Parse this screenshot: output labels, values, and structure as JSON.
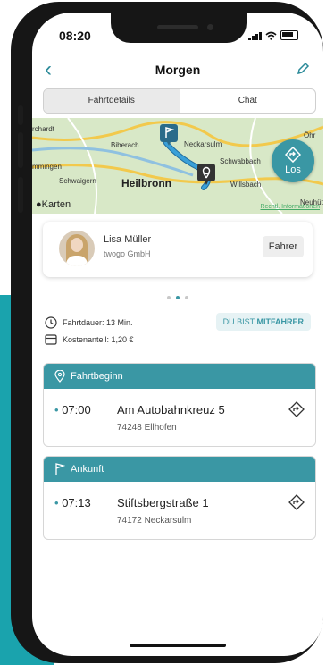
{
  "status_bar": {
    "time": "08:20"
  },
  "nav": {
    "title": "Morgen",
    "back_icon": "chevron-left-icon",
    "edit_icon": "pencil-icon"
  },
  "tabs": [
    {
      "label": "Fahrtdetails",
      "active": true
    },
    {
      "label": "Chat",
      "active": false
    }
  ],
  "map": {
    "places": [
      "rchardt",
      "Biberach",
      "Neckarsulm",
      "Schwabbach",
      "Öhr",
      "mmingen",
      "Schwaigern",
      "Heilbronn",
      "Willsbach",
      "Neuhütt"
    ],
    "provider": "Karten",
    "legal_link": "Rechtl. Informationen",
    "go_button_label": "Los"
  },
  "driver": {
    "name": "Lisa Müller",
    "company": "twogo GmbH",
    "role_label": "Fahrer"
  },
  "pager": {
    "count": 3,
    "active_index": 1
  },
  "trip_info": {
    "duration": "Fahrtdauer: 13 Min.",
    "cost": "Kostenanteil: 1,20 €",
    "badge_prefix": "DU BIST",
    "badge_strong": "MITFAHRER"
  },
  "start": {
    "header": "Fahrtbeginn",
    "time": "07:00",
    "street": "Am Autobahnkreuz 5",
    "city": "74248 Ellhofen"
  },
  "arrival": {
    "header": "Ankunft",
    "time": "07:13",
    "street": "Stiftsbergstraße 1",
    "city": "74172 Neckarsulm"
  },
  "colors": {
    "accent": "#3a97a4",
    "backdrop": "#1aa3ad"
  }
}
